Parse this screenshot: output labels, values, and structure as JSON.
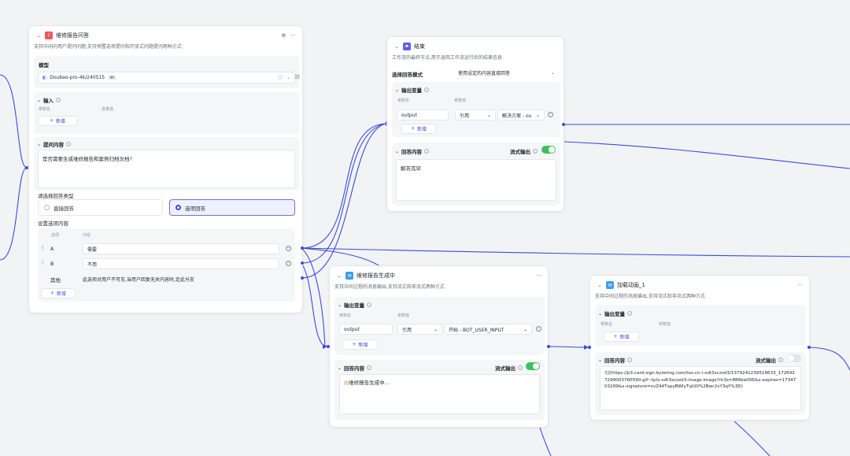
{
  "colors": {
    "accent": "#3b4bd9",
    "toggle_on": "#3ec25e",
    "qa_icon": "#f0565b",
    "end_icon": "#5b5fe8",
    "msg_icon": "#3a9df0"
  },
  "qa_node": {
    "title": "维修报告问答",
    "description": "支持中间向用户提问问题,支持预置选项提问和开放式问题提问两种方式",
    "model_label": "模型",
    "model_name": "Doubao-pro-4k/240515",
    "model_badge": "4K",
    "input_label": "输入",
    "param_name_col": "参数名",
    "param_value_col": "变量值",
    "add_label": "新增",
    "question_label": "提问内容",
    "question_text": "是否需要生成维修报告和案例归档文档?",
    "answer_type_label": "请选择回答类型",
    "answer_direct": "直接回答",
    "answer_options": "选项回答",
    "options_label": "设置选项内容",
    "col_option": "选项",
    "col_content": "内容",
    "options": [
      {
        "key": "A",
        "value": "需要"
      },
      {
        "key": "B",
        "value": "不用"
      }
    ],
    "other_key": "其他",
    "other_text": "此选项对用户不可见,当用户回复无关内容时,走此分支",
    "add_option": "新增"
  },
  "end_node": {
    "title": "结束",
    "description": "工作流的最终节点,用于返回工作流运行后的结果信息",
    "mode_label": "选择回答模式",
    "mode_value": "使用设定的内容直接回答",
    "output_label": "输出变量",
    "param_name_col": "参数名",
    "param_value_col": "参数值",
    "var_name": "output",
    "var_type": "引用",
    "var_value": "解决方案 - ou",
    "add_label": "新增",
    "answer_label": "回答内容",
    "stream_label": "流式输出",
    "answer_text": "解答完毕"
  },
  "gen_node": {
    "title": "维修报告生成中",
    "description": "支持中间过程的消息输出,支持流式和非流式两种方式",
    "output_label": "输出变量",
    "param_name_col": "参数名",
    "param_value_col": "参数值",
    "var_name": "output",
    "var_type": "引用",
    "var_value": "开始 - BOT_USER_INPUT",
    "add_label": "新增",
    "answer_label": "回答内容",
    "stream_label": "流式输出",
    "answer_text": "维修报告生成中..."
  },
  "anim_node": {
    "title": "加载动画_1",
    "description": "支持中间过程的消息输出,支持流式和非流式两种方式",
    "output_label": "输出变量",
    "param_name_col": "参数名",
    "param_value_col": "参数值",
    "add_label": "新增",
    "answer_label": "回答内容",
    "stream_label": "流式输出",
    "answer_text": "![](https://p3-card-sign.byteimg.com/tos-cn-i-xdt3xczzd3/1379241239518633_1726927299003760590.gif~tplv-xdt3xczzd3-image.image?rk3s=886be006&x-expires=1734703299&x-signature=xvZ44TxpyBWIyTqiU0%2Bwr2vY3qY%3D)"
  }
}
